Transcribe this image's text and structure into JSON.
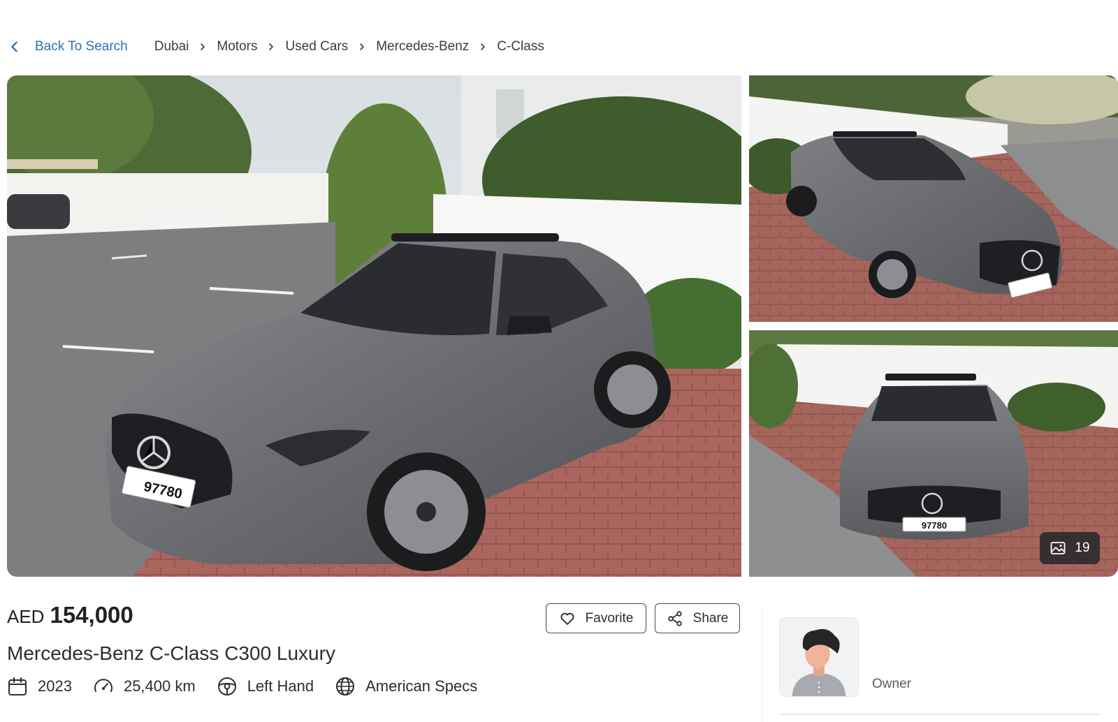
{
  "breadcrumb": {
    "back_label": "Back To Search",
    "items": [
      "Dubai",
      "Motors",
      "Used Cars",
      "Mercedes-Benz",
      "C-Class"
    ]
  },
  "gallery": {
    "photo_count": "19",
    "plate_text": "97780"
  },
  "listing": {
    "currency": "AED",
    "price": "154,000",
    "title": "Mercedes-Benz C-Class C300 Luxury",
    "specs": {
      "year": "2023",
      "mileage": "25,400 km",
      "steering": "Left Hand",
      "regional_specs": "American Specs"
    }
  },
  "actions": {
    "favorite_label": "Favorite",
    "share_label": "Share"
  },
  "seller": {
    "role": "Owner"
  },
  "colors": {
    "link": "#2f6fb7",
    "text": "#2b2d33",
    "car_body": "#6d6f73",
    "paving": "#a9655e"
  },
  "icons": [
    "chevron-left-icon",
    "chevron-right-icon",
    "gallery-icon",
    "heart-icon",
    "share-icon",
    "calendar-icon",
    "speedometer-icon",
    "steering-wheel-icon",
    "globe-icon"
  ]
}
